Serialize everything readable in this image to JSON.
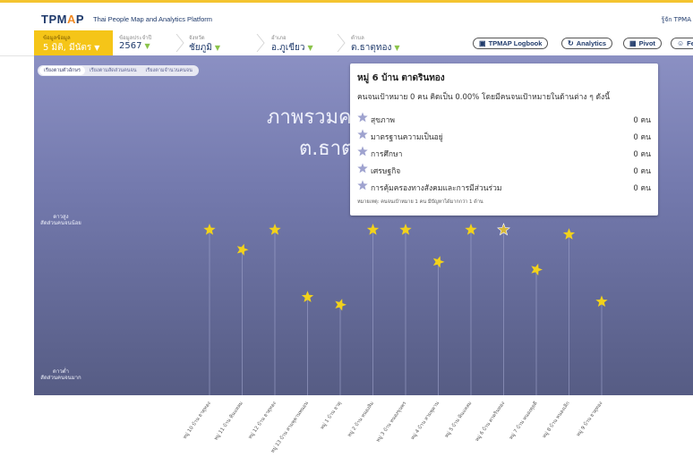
{
  "header": {
    "logo_main": "TPM",
    "logo_arrow": "A",
    "logo_end": "P",
    "tagline": "Thai People Map and Analytics Platform",
    "about": "รู้จัก TPMA"
  },
  "filters": [
    {
      "label": "ข้อมูลข้อมูล",
      "value": "5 มิติ, มีนัตร",
      "active": true
    },
    {
      "label": "ข้อมูลประจำปี",
      "value": "2567",
      "active": false
    },
    {
      "label": "จังหวัด",
      "value": "ชัยภูมิ",
      "active": false
    },
    {
      "label": "อำเภอ",
      "value": "อ.ภูเขียว",
      "active": false
    },
    {
      "label": "ตำบล",
      "value": "ต.ธาตุทอง",
      "active": false
    }
  ],
  "nav": {
    "logbook": "TPMAP Logbook",
    "analytics": "Analytics",
    "pivot": "Pivot",
    "feedback": "Fe"
  },
  "tabs": [
    {
      "label": "เรียงตามตัวอักษร",
      "selected": true
    },
    {
      "label": "เรียงตามสัดส่วนคนจน",
      "selected": false
    },
    {
      "label": "เรียงตามจำนวนคนจน",
      "selected": false
    }
  ],
  "chart": {
    "title_line1": "ภาพรวมค",
    "title_line2": "ต.ธาต",
    "y_top_label": "ดาวสูง\nสัดส่วนคนจนน้อย",
    "y_bottom_label": "ดาวต่ำ\nสัดส่วนคนจนมาก",
    "star_color": "#f2d21b",
    "highlight_color": "#d8b93a"
  },
  "chart_data": {
    "type": "scatter",
    "categories": [
      "หมู่ 10 บ้าน ธาตุทอง",
      "หมู่ 11 บ้าน หินแหลม",
      "หมู่ 12 บ้าน ธาตุทอง",
      "หมู่ 13 บ้าน สามพุคานพนอน",
      "หมู่ 1 บ้าน ธาตุ",
      "หมู่ 2 บ้าน หนองสิม",
      "หมู่ 3 บ้าน หนองขุนพร",
      "หมู่ 4 บ้าน สามพุคาน",
      "หมู่ 5 บ้าน หินแหลม",
      "หมู่ 6 บ้าน ตาดรินทอง",
      "หมู่ 7 บ้าน หนองคุยคี",
      "หมู่ 8 บ้าน หนองเลิก",
      "หมู่ 9 บ้าน ธาตุทอง"
    ],
    "values": [
      100,
      87,
      100,
      56,
      51,
      100,
      100,
      79,
      100,
      100,
      74,
      97,
      53
    ],
    "highlight_index": 9,
    "ylim": [
      0,
      100
    ]
  },
  "tooltip": {
    "title": "หมู่ 6 บ้าน ตาดรินทอง",
    "subtitle": "คนจนเป้าหมาย 0 คน คิดเป็น 0.00% โดยมีคนจนเป้าหมายในด้านต่าง ๆ ดังนี้",
    "rows": [
      {
        "name": "สุขภาพ",
        "count": "0 คน"
      },
      {
        "name": "มาตรฐานความเป็นอยู่",
        "count": "0 คน"
      },
      {
        "name": "การศึกษา",
        "count": "0 คน"
      },
      {
        "name": "เศรษฐกิจ",
        "count": "0 คน"
      },
      {
        "name": "การคุ้มครองทางสังคมและการมีส่วนร่วม",
        "count": "0 คน"
      }
    ],
    "note": "หมายเหตุ: คนจนเป้าหมาย 1 คน มีปัญหาได้มากกว่า 1 ด้าน",
    "row_star_color": "#9fa3cf"
  }
}
